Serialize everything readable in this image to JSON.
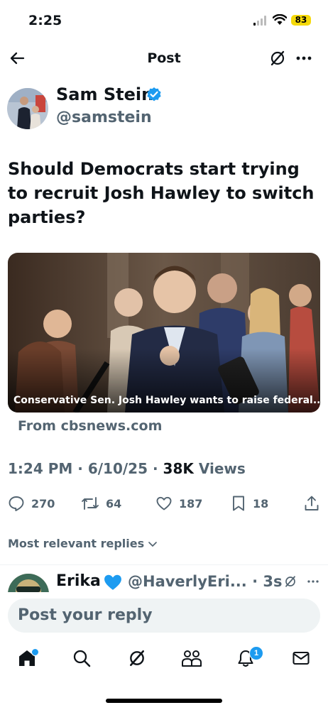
{
  "status_bar": {
    "time": "2:25",
    "battery": "83"
  },
  "header": {
    "title": "Post"
  },
  "author": {
    "name": "Sam Stein",
    "handle": "@samstein"
  },
  "post": {
    "text": "Should Democrats start trying to recruit Josh Hawley to switch parties?",
    "card": {
      "caption": "Conservative Sen. Josh Hawley wants to raise federal...",
      "source": "From cbsnews.com"
    },
    "time": "1:24 PM",
    "date": "6/10/25",
    "views_count": "38K",
    "views_label": "Views"
  },
  "stats": {
    "replies": "270",
    "reposts": "64",
    "likes": "187",
    "bookmarks": "18"
  },
  "replies_sort": {
    "label": "Most relevant replies"
  },
  "first_reply": {
    "name": "Erika",
    "handle": "@HaverlyEri...",
    "time": "3s"
  },
  "reply_input": {
    "placeholder": "Post your reply"
  },
  "bottom_nav": {
    "notifications_badge": "1"
  },
  "icons": {
    "back": "arrow-left-icon",
    "grok": "grok-icon",
    "more": "more-icon",
    "verified": "verified-badge-icon",
    "reply": "reply-icon",
    "repost": "repost-icon",
    "like": "heart-icon",
    "bookmark": "bookmark-icon",
    "share": "share-icon",
    "home": "home-icon",
    "search": "search-icon",
    "communities": "communities-icon",
    "notifications": "bell-icon",
    "messages": "mail-icon"
  },
  "colors": {
    "accent": "#1d9bf0",
    "text": "#0f1419",
    "secondary": "#536471",
    "battery": "#f5d90a"
  }
}
